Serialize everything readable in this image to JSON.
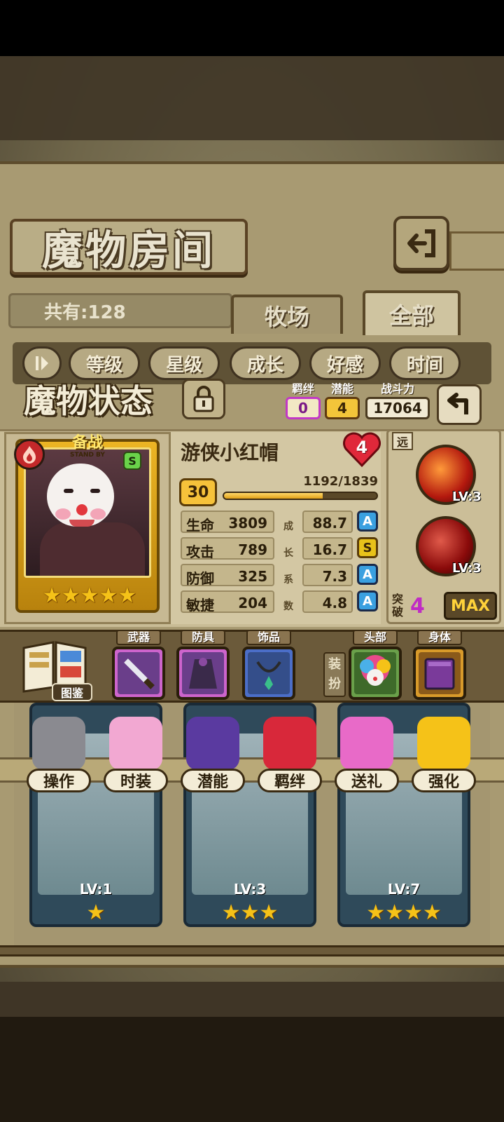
{
  "header": {
    "title": "魔物房间",
    "count_label": "共有:128"
  },
  "tabs": [
    {
      "label": "牧场"
    },
    {
      "label": "全部"
    }
  ],
  "sort_options": [
    {
      "label": "等级"
    },
    {
      "label": "星级"
    },
    {
      "label": "成长"
    },
    {
      "label": "好感"
    },
    {
      "label": "时间"
    }
  ],
  "status": {
    "title": "魔物状态",
    "bond_label": "羁绊",
    "bond_value": "0",
    "potential_label": "潜能",
    "potential_value": "4",
    "power_label": "战斗力",
    "power_value": "17064"
  },
  "hero": {
    "name": "游侠小红帽",
    "affection_level": "4",
    "level": "30",
    "exp_text": "1192/1839",
    "exp_fraction": 0.648,
    "standby_cn": "备战",
    "standby_en": "STAND BY",
    "rank": "S",
    "stars": [
      "★",
      "★",
      "★",
      "★",
      "★"
    ],
    "range": "远"
  },
  "attributes": [
    {
      "name": "生命",
      "value": "3809",
      "coef": "88.7",
      "grade": "A"
    },
    {
      "name": "攻击",
      "value": "789",
      "coef": "16.7",
      "grade": "S"
    },
    {
      "name": "防御",
      "value": "325",
      "coef": "7.3",
      "grade": "A"
    },
    {
      "name": "敏捷",
      "value": "204",
      "coef": "4.8",
      "grade": "A"
    }
  ],
  "coef_chars": [
    "成",
    "长",
    "系",
    "数"
  ],
  "skills": [
    {
      "lv": "LV:3"
    },
    {
      "lv": "LV:3"
    }
  ],
  "breakthrough": {
    "label": "突破",
    "value": "4",
    "max_label": "MAX"
  },
  "equipment": {
    "book_label": "图鉴",
    "weapon_label": "武器",
    "armor_label": "防具",
    "accessory_label": "饰品",
    "dress_label": "装扮",
    "head_label": "头部",
    "body_label": "身体"
  },
  "actions": [
    {
      "label": "操作"
    },
    {
      "label": "时装"
    },
    {
      "label": "潜能"
    },
    {
      "label": "羁绊"
    },
    {
      "label": "送礼"
    },
    {
      "label": "强化"
    }
  ],
  "cards": [
    {
      "lv": "LV:1",
      "stars": "★"
    },
    {
      "lv": "LV:3",
      "stars": "★★★"
    },
    {
      "lv": "LV:7",
      "stars": "★★★★"
    }
  ]
}
